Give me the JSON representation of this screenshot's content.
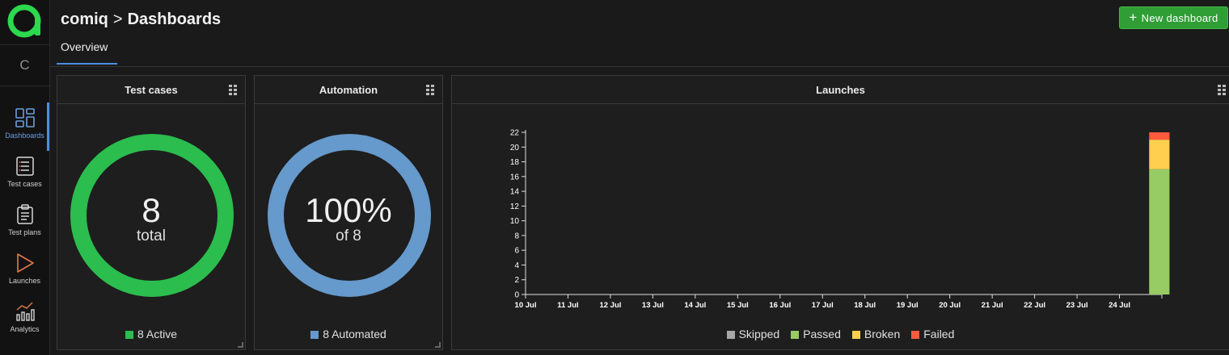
{
  "nav": {
    "project_initial": "C",
    "items": [
      {
        "label": "Dashboards",
        "icon": "dashboards-icon",
        "active": true
      },
      {
        "label": "Test cases",
        "icon": "test-cases-icon",
        "active": false
      },
      {
        "label": "Test plans",
        "icon": "test-plans-icon",
        "active": false
      },
      {
        "label": "Launches",
        "icon": "launches-icon",
        "active": false
      },
      {
        "label": "Analytics",
        "icon": "analytics-icon",
        "active": false
      }
    ]
  },
  "header": {
    "project": "comiq",
    "separator": ">",
    "page": "Dashboards",
    "new_button": "New dashboard",
    "new_button_icon": "plus-icon"
  },
  "tabs": [
    {
      "label": "Overview",
      "active": true
    }
  ],
  "widgets": {
    "test_cases": {
      "title": "Test cases",
      "value": "8",
      "sub": "total",
      "legend": "8 Active",
      "color": "#2bbd4e",
      "fraction": 1.0
    },
    "automation": {
      "title": "Automation",
      "value": "100%",
      "sub": "of 8",
      "legend": "8 Automated",
      "color": "#6699cc",
      "fraction": 1.0
    },
    "launches": {
      "title": "Launches"
    }
  },
  "chart_data": {
    "type": "bar",
    "stacked": true,
    "categories": [
      "10 Jul",
      "11 Jul",
      "12 Jul",
      "13 Jul",
      "14 Jul",
      "15 Jul",
      "16 Jul",
      "17 Jul",
      "18 Jul",
      "19 Jul",
      "20 Jul",
      "21 Jul",
      "22 Jul",
      "23 Jul",
      "24 Jul"
    ],
    "series": [
      {
        "name": "Skipped",
        "color": "#a6a6a6",
        "values": [
          0,
          0,
          0,
          0,
          0,
          0,
          0,
          0,
          0,
          0,
          0,
          0,
          0,
          0,
          0
        ]
      },
      {
        "name": "Passed",
        "color": "#97cc64",
        "values": [
          0,
          0,
          0,
          0,
          0,
          0,
          0,
          0,
          0,
          0,
          0,
          0,
          0,
          0,
          17
        ]
      },
      {
        "name": "Broken",
        "color": "#ffd050",
        "values": [
          0,
          0,
          0,
          0,
          0,
          0,
          0,
          0,
          0,
          0,
          0,
          0,
          0,
          0,
          4
        ]
      },
      {
        "name": "Failed",
        "color": "#fd5a3e",
        "values": [
          0,
          0,
          0,
          0,
          0,
          0,
          0,
          0,
          0,
          0,
          0,
          0,
          0,
          0,
          1
        ]
      }
    ],
    "yticks": [
      0,
      2,
      4,
      6,
      8,
      10,
      12,
      14,
      16,
      18,
      20,
      22
    ],
    "ylim": [
      0,
      22
    ],
    "legend_position": "bottom",
    "grid": false
  }
}
